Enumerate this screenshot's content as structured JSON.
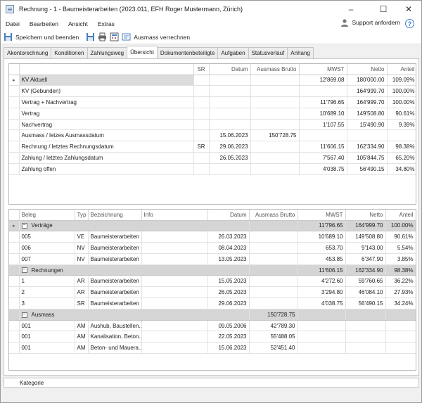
{
  "window": {
    "title": "Rechnung - 1 - Baumeisterarbeiten (2023.011, EFH Roger Mustermann, Zürich)"
  },
  "menu": [
    "Datei",
    "Bearbeiten",
    "Ansicht",
    "Extras"
  ],
  "support": {
    "label": "Support anfordern"
  },
  "toolbar": {
    "save_close": "Speichern und beenden",
    "ausmass": "Ausmass verrechnen"
  },
  "tabs": [
    "Akontorechnung",
    "Konditionen",
    "Zahlungsweg",
    "Übersicht",
    "Dokumentenbeteiligte",
    "Aufgaben",
    "Statusverlauf",
    "Anhang"
  ],
  "active_tab": "Übersicht",
  "summary": {
    "headers": [
      "",
      "SR",
      "Datum",
      "Ausmass Brutto",
      "MWST",
      "Netto",
      "Anteil"
    ],
    "rows": [
      {
        "name": "KV Aktuell",
        "sr": "",
        "datum": "",
        "ausmass": "",
        "mwst": "12'869.08",
        "netto": "180'000.00",
        "anteil": "109.09%"
      },
      {
        "name": "KV (Gebunden)",
        "sr": "",
        "datum": "",
        "ausmass": "",
        "mwst": "",
        "netto": "164'999.70",
        "anteil": "100.00%"
      },
      {
        "name": "Vertrag + Nachvertrag",
        "sr": "",
        "datum": "",
        "ausmass": "",
        "mwst": "11'796.65",
        "netto": "164'999.70",
        "anteil": "100.00%"
      },
      {
        "name": "Vertrag",
        "sr": "",
        "datum": "",
        "ausmass": "",
        "mwst": "10'689.10",
        "netto": "149'508.80",
        "anteil": "90.61%"
      },
      {
        "name": "Nachvertrag",
        "sr": "",
        "datum": "",
        "ausmass": "",
        "mwst": "1'107.55",
        "netto": "15'490.90",
        "anteil": "9.39%"
      },
      {
        "name": "Ausmass / letzes Ausmassdatum",
        "sr": "",
        "datum": "15.06.2023",
        "ausmass": "150'728.75",
        "mwst": "",
        "netto": "",
        "anteil": ""
      },
      {
        "name": "Rechnung / letztes Rechnungsdatum",
        "sr": "SR",
        "datum": "29.06.2023",
        "ausmass": "",
        "mwst": "11'606.15",
        "netto": "162'334.90",
        "anteil": "98.38%"
      },
      {
        "name": "Zahlung / letztes Zahlungsdatum",
        "sr": "",
        "datum": "26.05.2023",
        "ausmass": "",
        "mwst": "7'567.40",
        "netto": "105'844.75",
        "anteil": "65.20%"
      },
      {
        "name": "Zahlung offen",
        "sr": "",
        "datum": "",
        "ausmass": "",
        "mwst": "4'038.75",
        "netto": "56'490.15",
        "anteil": "34.80%"
      }
    ]
  },
  "details": {
    "headers": [
      "Beleg",
      "Typ",
      "Bezeichnung",
      "Info",
      "Datum",
      "Ausmass Brutto",
      "MWST",
      "Netto",
      "Anteil"
    ],
    "groups": [
      {
        "title": "Verträge",
        "ausmass": "",
        "mwst": "11'796.65",
        "netto": "164'999.70",
        "anteil": "100.00%",
        "rows": [
          {
            "beleg": "005",
            "typ": "VE",
            "bez": "Baumeisterarbeiten",
            "info": "",
            "datum": "26.03.2023",
            "ausmass": "",
            "mwst": "10'689.10",
            "netto": "149'508.80",
            "anteil": "90.61%"
          },
          {
            "beleg": "006",
            "typ": "NV",
            "bez": "Baumeisterarbeiten",
            "info": "",
            "datum": "08.04.2023",
            "ausmass": "",
            "mwst": "653.70",
            "netto": "9'143.00",
            "anteil": "5.54%"
          },
          {
            "beleg": "007",
            "typ": "NV",
            "bez": "Baumeisterarbeiten",
            "info": "",
            "datum": "13.05.2023",
            "ausmass": "",
            "mwst": "453.85",
            "netto": "6'347.90",
            "anteil": "3.85%"
          }
        ]
      },
      {
        "title": "Rechnungen",
        "ausmass": "",
        "mwst": "11'606.15",
        "netto": "162'334.90",
        "anteil": "98.38%",
        "rows": [
          {
            "beleg": "1",
            "typ": "AR",
            "bez": "Baumeisterarbeiten",
            "info": "",
            "datum": "15.05.2023",
            "ausmass": "",
            "mwst": "4'272.60",
            "netto": "59'760.65",
            "anteil": "36.22%"
          },
          {
            "beleg": "2",
            "typ": "AR",
            "bez": "Baumeisterarbeiten",
            "info": "",
            "datum": "26.05.2023",
            "ausmass": "",
            "mwst": "3'294.80",
            "netto": "46'084.10",
            "anteil": "27.93%"
          },
          {
            "beleg": "3",
            "typ": "SR",
            "bez": "Baumeisterarbeiten",
            "info": "",
            "datum": "29.06.2023",
            "ausmass": "",
            "mwst": "4'038.75",
            "netto": "56'490.15",
            "anteil": "34.24%"
          }
        ]
      },
      {
        "title": "Ausmass",
        "ausmass": "150'728.75",
        "mwst": "",
        "netto": "",
        "anteil": "",
        "rows": [
          {
            "beleg": "001",
            "typ": "AM",
            "bez": "Aushub, Baustellen...",
            "info": "",
            "datum": "09.05.2006",
            "ausmass": "42'789.30",
            "mwst": "",
            "netto": "",
            "anteil": ""
          },
          {
            "beleg": "001",
            "typ": "AM",
            "bez": "Kanalisation, Beton...",
            "info": "",
            "datum": "22.05.2023",
            "ausmass": "55'488.05",
            "mwst": "",
            "netto": "",
            "anteil": ""
          },
          {
            "beleg": "001",
            "typ": "AM",
            "bez": "Beton- und Mauera...",
            "info": "",
            "datum": "15.06.2023",
            "ausmass": "52'451.40",
            "mwst": "",
            "netto": "",
            "anteil": ""
          }
        ]
      }
    ]
  },
  "footer": {
    "label": "Kategorie"
  }
}
